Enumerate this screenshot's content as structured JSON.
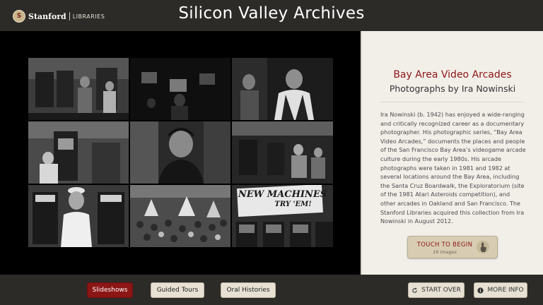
{
  "header": {
    "logo_stanford": "Stanford",
    "logo_libraries": "LIBRARIES",
    "title": "Silicon Valley Archives"
  },
  "gallery": {
    "sign_text_1": "NEW MACHINES",
    "sign_text_2": "TRY 'EM!"
  },
  "panel": {
    "title": "Bay Area Video Arcades",
    "subtitle": "Photographs by Ira Nowinski",
    "body": "Ira Nowinski (b. 1942) has enjoyed a wide-ranging and critically recognized career as a documentary photographer. His photographic series, “Bay Area Video Arcades,” documents the places and people of the San Francisco Bay Area’s videogame arcade culture during the early 1980s. His arcade photographs were taken in 1981 and 1982 at several locations around the Bay Area, including the Santa Cruz Boardwalk, the Exploratorium (site of the 1981 Atari Asteroids competition), and other arcades in Oakland and San Francisco. The Stanford Libraries acquired this collection from Ira Nowinski in August 2012.",
    "begin_label": "TOUCH TO BEGIN",
    "begin_count": "19 images",
    "begin_icon": "touch-hand-icon"
  },
  "footer": {
    "slideshows": "Slideshows",
    "guided_tours": "Guided Tours",
    "oral_histories": "Oral Histories",
    "start_over": "START OVER",
    "start_over_icon": "refresh-icon",
    "more_info": "MORE INFO",
    "more_info_icon": "info-icon"
  },
  "colors": {
    "accent": "#8c1515",
    "chrome": "#2d2b28",
    "panel_bg": "#f2efe9",
    "button_bg": "#e7e1d3"
  }
}
